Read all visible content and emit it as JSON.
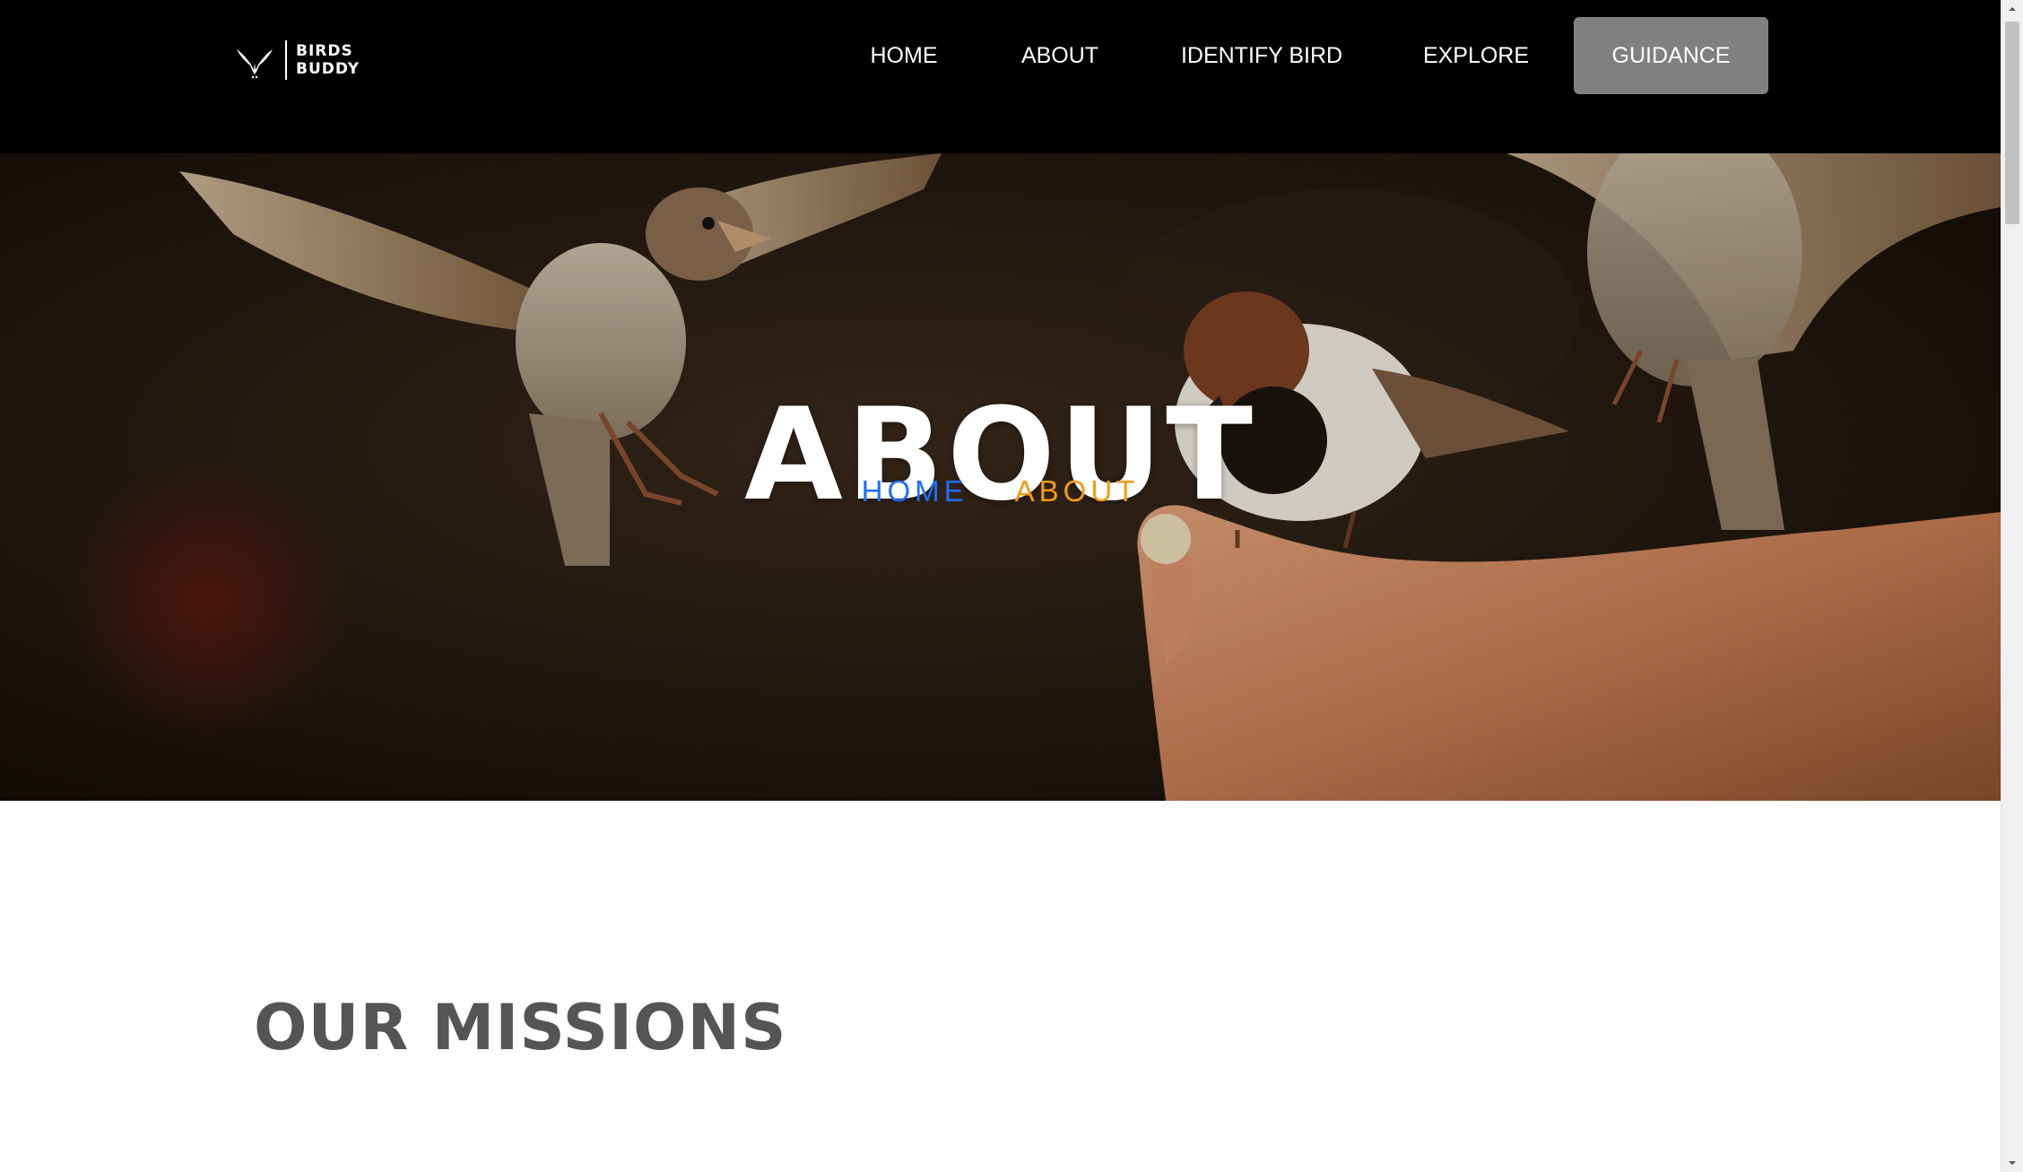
{
  "header": {
    "logo": {
      "line1": "BIRDS",
      "line2": "BUDDY",
      "icon": "bird-wings-icon"
    },
    "nav": [
      {
        "label": "HOME"
      },
      {
        "label": "ABOUT"
      },
      {
        "label": "IDENTIFY BIRD"
      },
      {
        "label": "EXPLORE"
      },
      {
        "label": "GUIDANCE",
        "active": true
      }
    ],
    "active_button_color": "#808080"
  },
  "hero": {
    "title": "ABOUT",
    "breadcrumb": {
      "home": "HOME",
      "separator": "-",
      "current": "ABOUT"
    },
    "colors": {
      "home_link": "#1e6fff",
      "current": "#f39c12"
    },
    "background_image": "sparrows-feeding-from-hand"
  },
  "content": {
    "section_title": "OUR MISSIONS",
    "section_title_color": "#555555"
  }
}
